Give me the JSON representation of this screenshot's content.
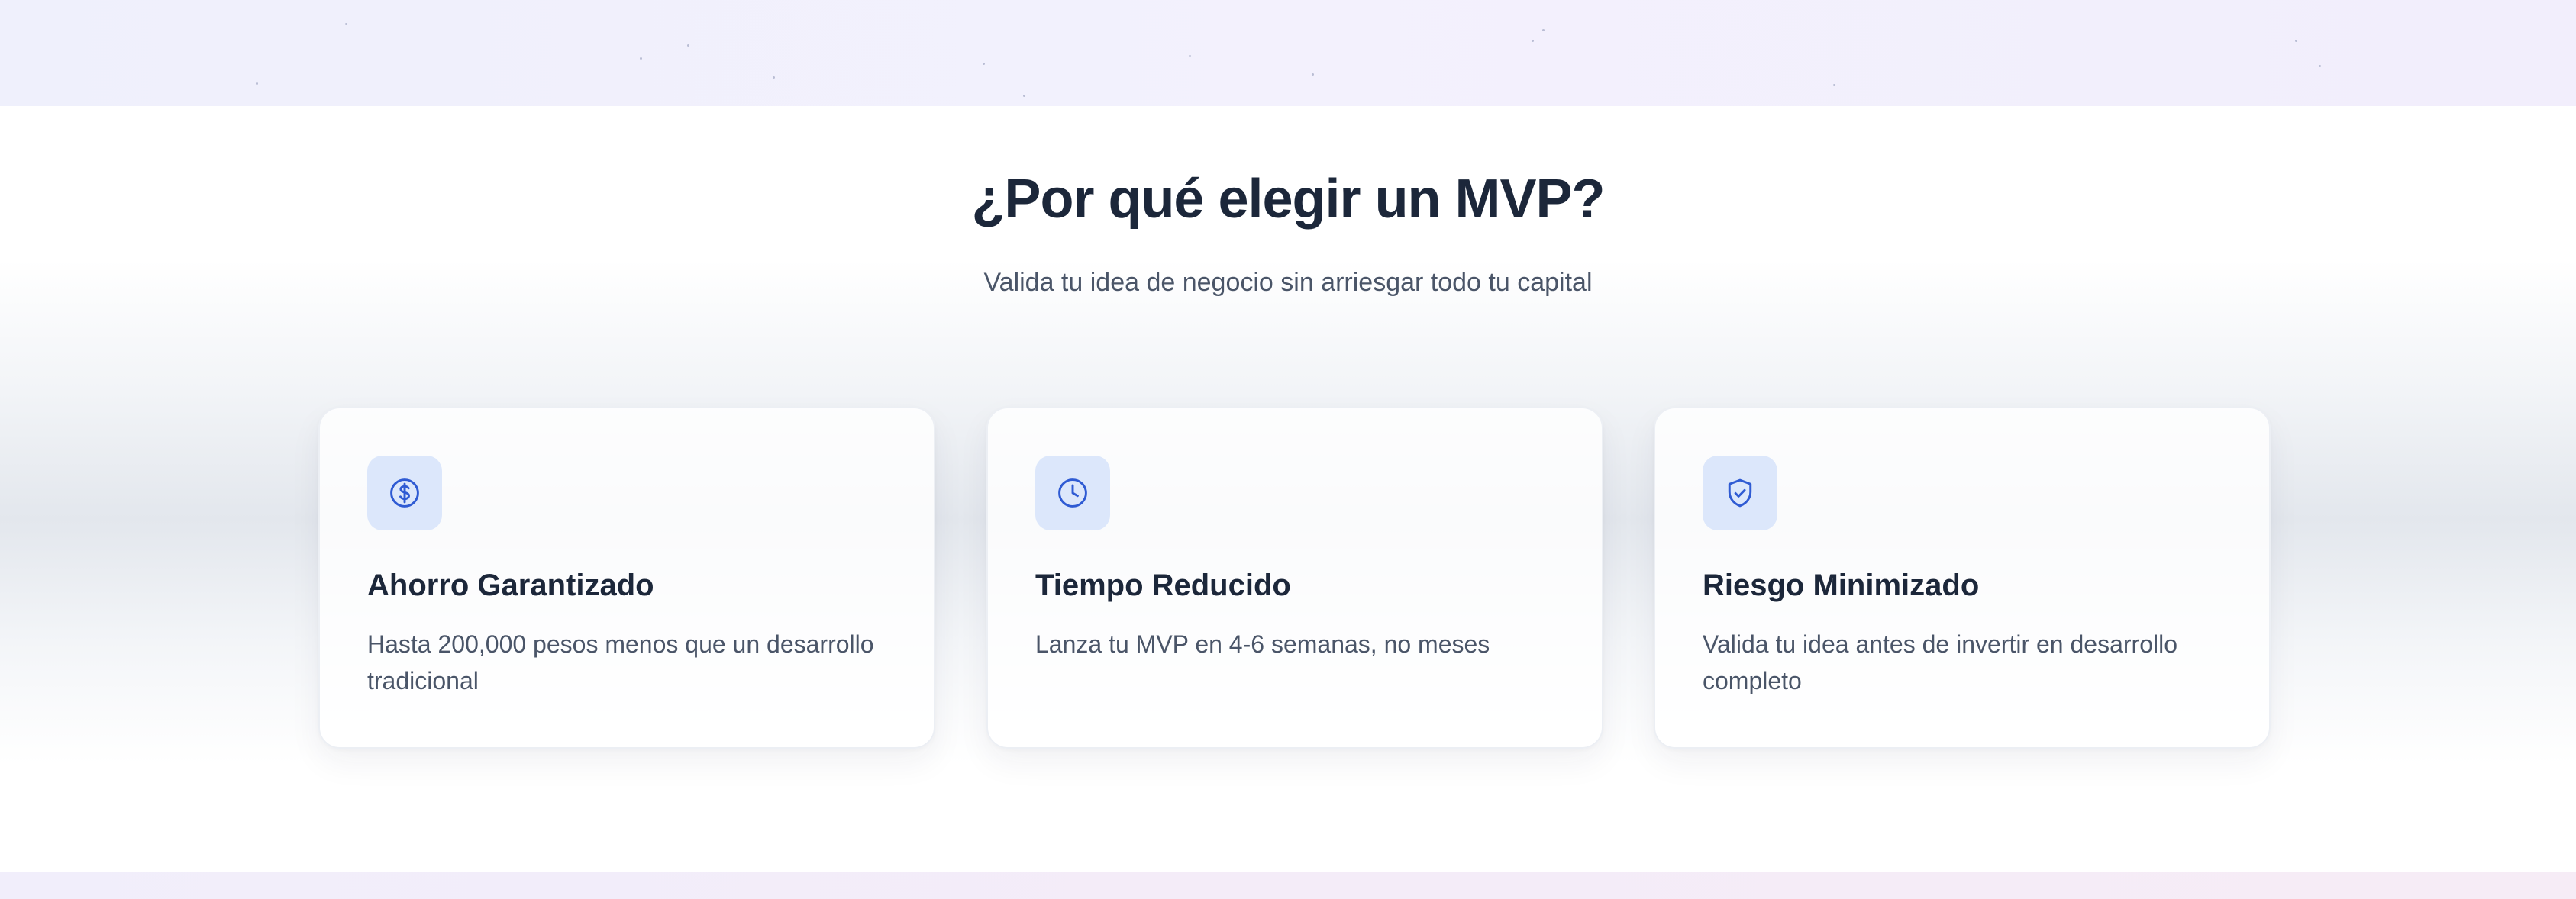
{
  "section": {
    "title": "¿Por qué elegir un MVP?",
    "subtitle": "Valida tu idea de negocio sin arriesgar todo tu capital"
  },
  "features": [
    {
      "icon": "dollar-circle-icon",
      "title": "Ahorro Garantizado",
      "description": "Hasta 200,000 pesos menos que un desarrollo tradicional"
    },
    {
      "icon": "clock-icon",
      "title": "Tiempo Reducido",
      "description": "Lanza tu MVP en 4-6 semanas, no meses"
    },
    {
      "icon": "shield-check-icon",
      "title": "Riesgo Minimizado",
      "description": "Valida tu idea antes de invertir en desarrollo completo"
    }
  ],
  "colors": {
    "heading": "#1c273a",
    "body_text": "#4a5568",
    "icon_accent": "#2f5bd3",
    "icon_background": "#dce7fb"
  }
}
